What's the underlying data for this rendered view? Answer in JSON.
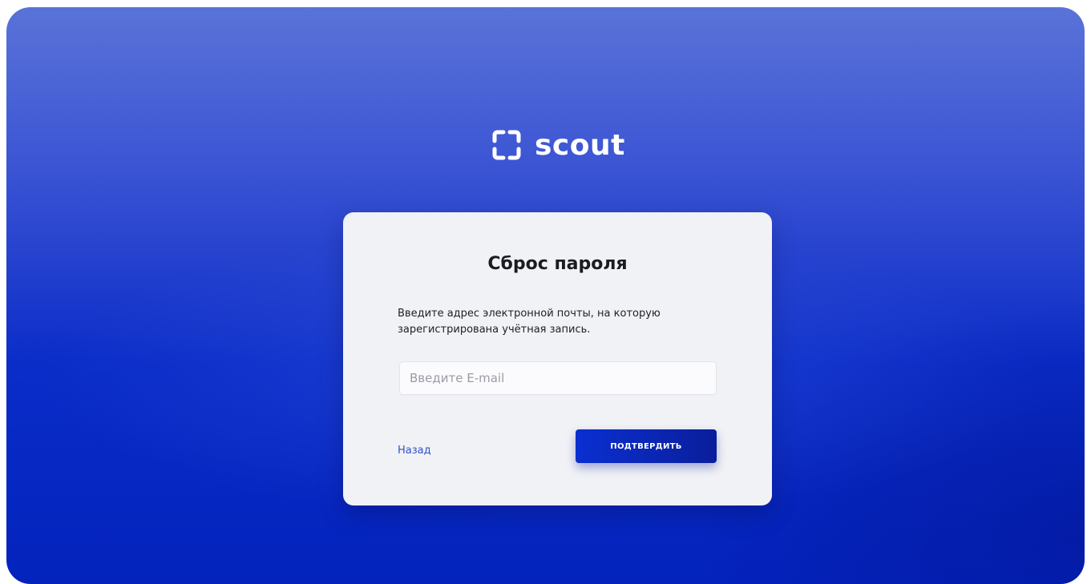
{
  "brand": {
    "name": "scout",
    "icon": "scout-brackets-logo-icon"
  },
  "reset": {
    "title": "Сброс пароля",
    "description": "Введите адрес электронной почты, на которую зарегистрирована учётная запись.",
    "email_placeholder": "Введите E-mail",
    "email_value": "",
    "back_label": "Назад",
    "submit_label": "ПОДТВЕРДИТЬ"
  },
  "colors": {
    "background_top": "#5a73d8",
    "background_bottom": "#0423bd",
    "card": "#f1f2f6",
    "link": "#2f52c7",
    "button": "#0a2fd1"
  }
}
